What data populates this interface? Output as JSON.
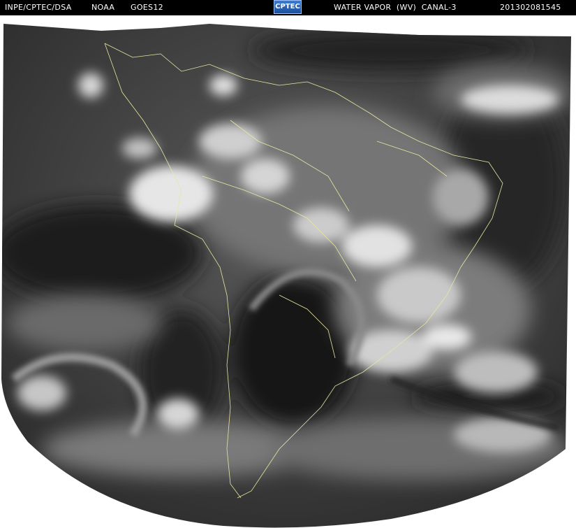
{
  "header": {
    "source": "INPE/CPTEC/DSA",
    "agency": "NOAA",
    "satellite": "GOES12",
    "logo_text": "CPTEC",
    "product": "WATER VAPOR  (WV)  CANAL-3",
    "timestamp": "201302081545"
  },
  "imagery": {
    "type": "satellite water vapor image",
    "background": "#ffffff",
    "coastline_color": "#e8e6a0",
    "tones": [
      "#101010",
      "#4a4a4a",
      "#9a9a9a",
      "#f2f2f2"
    ]
  }
}
